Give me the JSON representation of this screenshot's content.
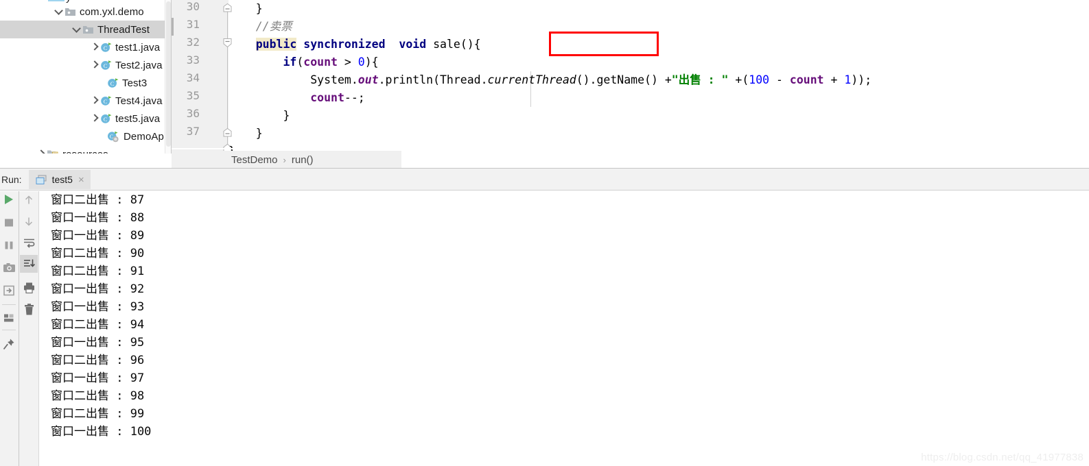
{
  "project_tree": {
    "name": "project-tree",
    "items": [
      {
        "label": "com.yxl.demo",
        "icon": "package-folder-icon",
        "twisty": "down",
        "indent": 78,
        "selected": false,
        "icon_type": "package"
      },
      {
        "label": "ThreadTest",
        "icon": "package-folder-icon",
        "twisty": "down",
        "indent": 104,
        "selected": true,
        "icon_type": "package"
      },
      {
        "label": "test1.java",
        "icon": "java-class-icon",
        "twisty": "right",
        "indent": 130,
        "selected": false,
        "icon_type": "class"
      },
      {
        "label": "Test2.java",
        "icon": "java-class-icon",
        "twisty": "right",
        "indent": 130,
        "selected": false,
        "icon_type": "class"
      },
      {
        "label": "Test3",
        "icon": "java-class-icon",
        "twisty": "none",
        "indent": 156,
        "selected": false,
        "icon_type": "class"
      },
      {
        "label": "Test4.java",
        "icon": "java-class-icon",
        "twisty": "right",
        "indent": 130,
        "selected": false,
        "icon_type": "class"
      },
      {
        "label": "test5.java",
        "icon": "java-class-icon",
        "twisty": "right",
        "indent": 130,
        "selected": false,
        "icon_type": "class"
      },
      {
        "label": "DemoApplic",
        "icon": "spring-boot-class-icon",
        "twisty": "none",
        "indent": 156,
        "selected": false,
        "icon_type": "spring"
      },
      {
        "label": "resources",
        "icon": "resources-folder-icon",
        "twisty": "right",
        "indent": 52,
        "selected": false,
        "icon_type": "resources"
      }
    ]
  },
  "editor": {
    "name": "code-editor",
    "line_numbers": [
      "30",
      "31",
      "32",
      "33",
      "34",
      "35",
      "36",
      "37"
    ],
    "lines": [
      {
        "num": "30",
        "text": "    }"
      },
      {
        "num": "31",
        "text": "    //卖票"
      },
      {
        "num": "32",
        "text": "    public synchronized  void sale(){"
      },
      {
        "num": "33",
        "text": "        if(count > 0){"
      },
      {
        "num": "34",
        "text": "            System.out.println(Thread.currentThread().getName() +\"出售 : \" +(100 - count + 1));"
      },
      {
        "num": "35",
        "text": "            count--;"
      },
      {
        "num": "36",
        "text": "        }"
      },
      {
        "num": "37",
        "text": "    }"
      }
    ],
    "tokens": {
      "comment": "//卖票",
      "kw_public": "public",
      "kw_synchronized": "synchronized",
      "kw_void": "void",
      "method_sale": "sale(){",
      "kw_if": "if",
      "field_count": "count",
      "num_zero": "0",
      "class_system": "System",
      "field_out": "out",
      "method_println": "println",
      "class_thread": "Thread",
      "method_currentthread": "currentThread",
      "method_getname": "getName",
      "string_chinese": "\"出售 : \"",
      "num_100": "100",
      "num_1": "1",
      "decrement": "count--;",
      "brace_close": "}"
    },
    "annotation": {
      "label": "red-highlight-box",
      "color": "#ff0000",
      "target": "synchronized"
    },
    "highlight_color": "#f2eac8"
  },
  "breadcrumb": {
    "name": "breadcrumb",
    "items": [
      "TestDemo",
      "run()"
    ],
    "separator": "›"
  },
  "run_panel": {
    "label": "Run:",
    "tab": {
      "name": "test5",
      "close": "×"
    },
    "toolbar_left": [
      {
        "name": "rerun-button",
        "icon": "play-icon"
      },
      {
        "name": "stop-button",
        "icon": "stop-square-icon"
      },
      {
        "name": "pause-button",
        "icon": "pause-bars-icon"
      },
      {
        "name": "screenshot-button",
        "icon": "camera-icon"
      },
      {
        "name": "export-button",
        "icon": "export-arrow-icon"
      },
      {
        "name": "layout-button",
        "icon": "layout-icon"
      },
      {
        "name": "pin-button",
        "icon": "pin-icon"
      }
    ],
    "toolbar_right": [
      {
        "name": "scroll-up-button",
        "icon": "arrow-up-icon",
        "active": false
      },
      {
        "name": "scroll-down-button",
        "icon": "arrow-down-icon",
        "active": false
      },
      {
        "name": "soft-wrap-button",
        "icon": "soft-wrap-icon",
        "active": false
      },
      {
        "name": "scroll-to-end-button",
        "icon": "scroll-to-end-icon",
        "active": true
      },
      {
        "name": "print-button",
        "icon": "printer-icon",
        "active": false
      },
      {
        "name": "clear-all-button",
        "icon": "trash-icon",
        "active": false
      }
    ]
  },
  "console": {
    "name": "console-output",
    "lines": [
      "窗口二出售 : 87",
      "窗口一出售 : 88",
      "窗口一出售 : 89",
      "窗口二出售 : 90",
      "窗口二出售 : 91",
      "窗口一出售 : 92",
      "窗口一出售 : 93",
      "窗口二出售 : 94",
      "窗口一出售 : 95",
      "窗口二出售 : 96",
      "窗口一出售 : 97",
      "窗口二出售 : 98",
      "窗口二出售 : 99",
      "窗口一出售 : 100"
    ]
  },
  "watermark": {
    "text": "https://blog.csdn.net/qq_41977838"
  }
}
